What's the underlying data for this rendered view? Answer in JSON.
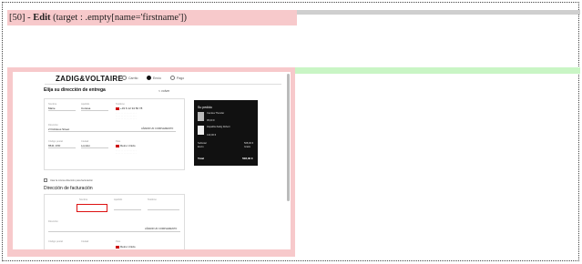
{
  "action": {
    "prefix": "[50] - ",
    "verb": "Edit",
    "target": " (target : .empty[name='firstname'])"
  },
  "screenshot": {
    "logo": "ZADIG&VOLTAIRE",
    "steps": [
      "Carrito",
      "Envío",
      "Pago"
    ],
    "shipping_title": "Elija su dirección de entrega",
    "back_link": "< volver",
    "shipping_fields": {
      "firstname_label": "Nombre",
      "firstname_value": "Marie",
      "lastname_label": "Apellido",
      "lastname_value": "Curiosa",
      "phone_label": "Teléfono",
      "phone_value": "+33 6 12 34 56 78",
      "address_label": "Dirección",
      "address_value": "2 Fictitious Street",
      "more_link": "AÑADIR UN COMPLEMENTO",
      "postcode_label": "Código postal",
      "postcode_value": "6541 1XD",
      "city_label": "Ciudad",
      "city_value": "London",
      "country_label": "País",
      "country_value": "Reino Unido"
    },
    "summary": {
      "title": "Su pedido",
      "item1_name": "Camisa Thunder",
      "item1_price": "95,00 €",
      "item2_name": "Zapatilla Zadig Robert",
      "item2_price": "413,00 €",
      "subtotal_label": "Subtotal",
      "subtotal_value": "508,00 €",
      "shipping_label": "Envío",
      "shipping_value": "Gratis",
      "total_label": "Total",
      "total_value": "508,00 €"
    },
    "billing_checkbox_label": "Usar la misma dirección para facturación",
    "billing_title": "Dirección de facturación",
    "billing_fields": {
      "firstname_label": "Nombre",
      "lastname_label": "Apellido",
      "phone_label": "Teléfono",
      "address_label": "Dirección",
      "more_link": "AÑADIR UN COMPLEMENTO",
      "postcode_label": "Código postal",
      "city_label": "Ciudad",
      "country_label": "País",
      "country_value": "Reino Unido"
    }
  }
}
